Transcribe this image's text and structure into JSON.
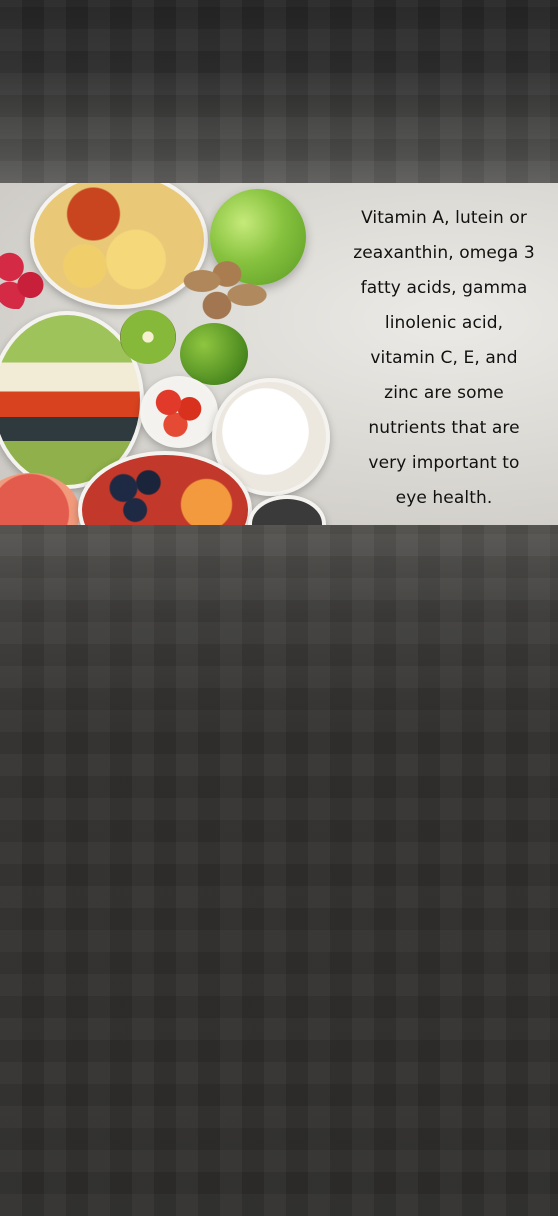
{
  "media": {
    "caption_lines": [
      "Vitamin A, lutein or",
      "zeaxanthin, omega 3",
      "fatty acids, gamma",
      "linolenic acid,",
      "vitamin C, E, and",
      "zinc are some",
      "nutrients that are",
      "very important to",
      "eye health."
    ]
  }
}
